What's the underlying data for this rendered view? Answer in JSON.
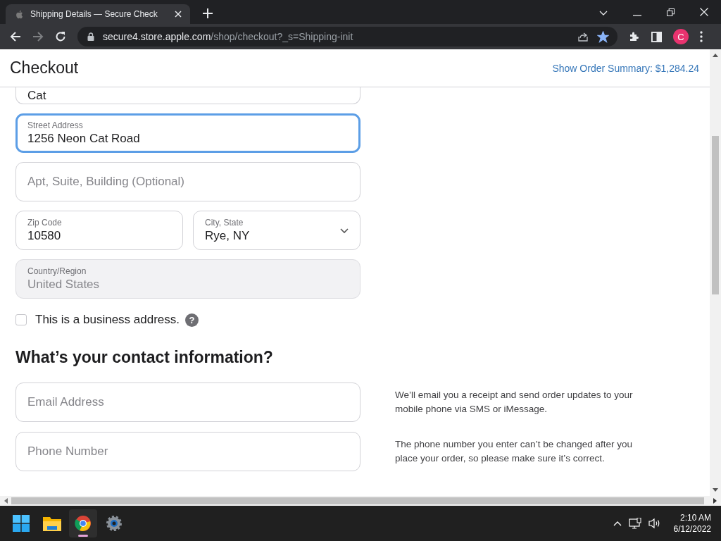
{
  "browser": {
    "tab": {
      "title": "Shipping Details — Secure Check",
      "selected": true
    },
    "url": {
      "host": "secure4.store.apple.com",
      "path": "/shop/checkout?_s=Shipping-init"
    },
    "bookmarked": true,
    "profile": "C"
  },
  "header": {
    "title": "Checkout",
    "order_summary": "Show Order Summary: $1,284.24"
  },
  "cut_field": {
    "value": "Cat"
  },
  "address_rows": [
    [
      {
        "kind": "text",
        "label": "Street Address",
        "value": "1256 Neon Cat Road",
        "focused": true,
        "disabled": false
      }
    ],
    [
      {
        "kind": "text",
        "placeholder": "Apt, Suite, Building (Optional)",
        "focused": false,
        "disabled": false
      }
    ],
    [
      {
        "kind": "text",
        "label": "Zip Code",
        "value": "10580",
        "focused": false,
        "disabled": false
      },
      {
        "kind": "select",
        "label": "City, State",
        "value": "Rye, NY",
        "focused": false,
        "disabled": false
      }
    ],
    [
      {
        "kind": "text",
        "label": "Country/Region",
        "value": "United States",
        "focused": false,
        "disabled": true
      }
    ]
  ],
  "business_checkbox": {
    "label": "This is a business address.",
    "checked": false,
    "help": "?"
  },
  "contact": {
    "heading": "What’s your contact information?",
    "rows": [
      {
        "placeholder": "Email Address",
        "note": "We’ll email you a receipt and send order updates to your mobile phone via SMS or iMessage."
      },
      {
        "placeholder": "Phone Number",
        "note": "The phone number you enter can’t be changed after you place your order, so please make sure it’s correct."
      }
    ]
  },
  "taskbar": {
    "apps": [
      {
        "kind": "start",
        "selected": false
      },
      {
        "kind": "folder",
        "selected": false
      },
      {
        "kind": "browser",
        "selected": true
      },
      {
        "kind": "settings",
        "selected": false
      }
    ],
    "time": "2:10 AM",
    "date": "6/12/2022"
  }
}
